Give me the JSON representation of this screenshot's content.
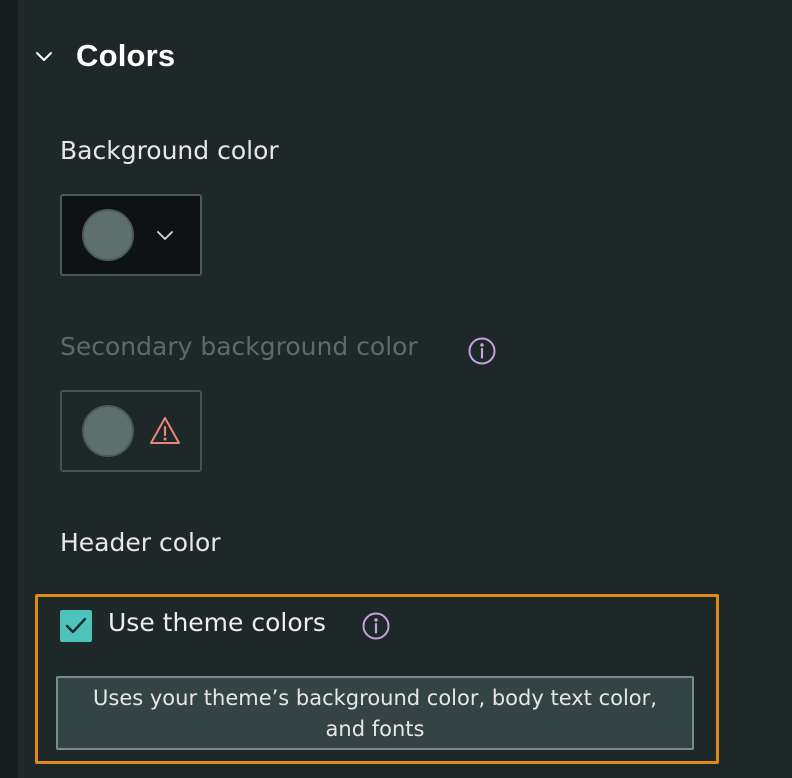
{
  "section": {
    "title": "Colors",
    "expanded": true,
    "chevron_icon": "chevron-down-icon"
  },
  "background_color": {
    "label": "Background color",
    "swatch_color": "#5d706d",
    "dropdown_icon": "chevron-down-icon"
  },
  "secondary_background_color": {
    "label": "Secondary background color",
    "state": "disabled",
    "info_icon": "info-icon",
    "swatch_color": "#5d706d",
    "status_icon": "warning-triangle-icon"
  },
  "header_color": {
    "label": "Header color",
    "use_theme": {
      "label": "Use theme colors",
      "checked": true,
      "info_icon": "info-icon",
      "tooltip_line1": "Uses your theme’s background color, body text color,",
      "tooltip_line2": "and fonts"
    }
  },
  "colors": {
    "panel_bg": "#1e2828",
    "accent_teal": "#4ec3bb",
    "info_purple": "#c7a2e0",
    "warning_red": "#e8857c",
    "highlight_orange": "#e18a17"
  }
}
